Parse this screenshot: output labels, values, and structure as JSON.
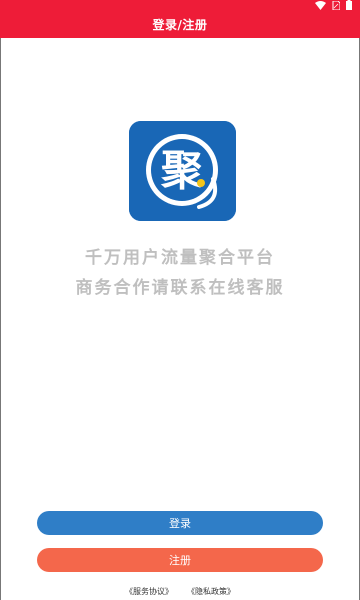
{
  "header": {
    "title": "登录/注册"
  },
  "status_bar": {
    "icons": [
      "wifi-icon",
      "sim-card-icon",
      "battery-icon"
    ]
  },
  "logo": {
    "character": "聚",
    "icon": "app-logo-icon"
  },
  "slogan": {
    "line1": "千万用户流量聚合平台",
    "line2": "商务合作请联系在线客服"
  },
  "buttons": {
    "login": "登录",
    "register": "注册"
  },
  "agreements": {
    "service": "《服务协议》",
    "privacy": "《隐私政策》"
  },
  "colors": {
    "header": "#ee1c38",
    "logo_bg": "#1967b6",
    "login_button": "#2f7ec7",
    "register_button": "#f4674b",
    "slogan_text": "#bfbfbf"
  }
}
